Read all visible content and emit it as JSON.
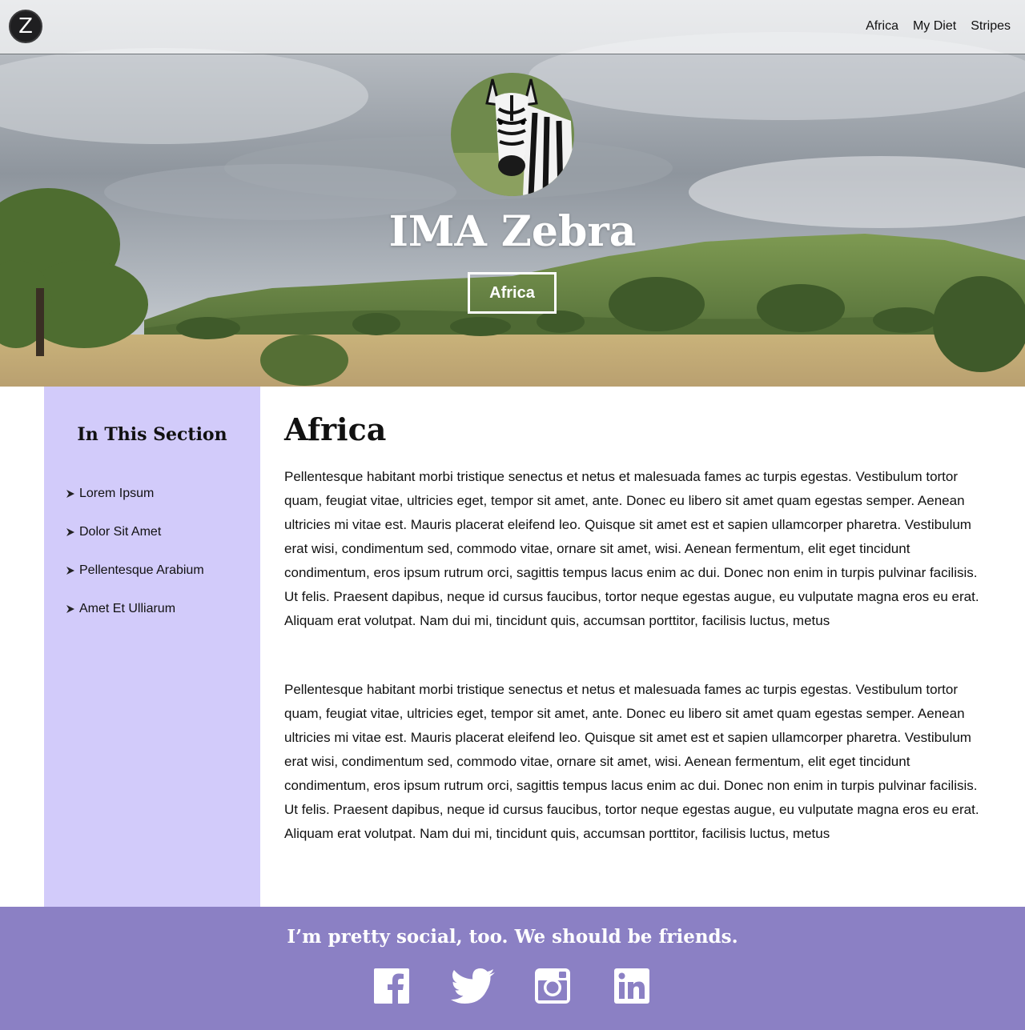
{
  "nav": {
    "logo_letter": "Z",
    "links": [
      "Africa",
      "My Diet",
      "Stripes"
    ]
  },
  "hero": {
    "title": "IMA Zebra",
    "button_label": "Africa"
  },
  "sidebar": {
    "title": "In This Section",
    "items": [
      {
        "label": "Lorem Ipsum"
      },
      {
        "label": "Dolor Sit Amet"
      },
      {
        "label": "Pellentesque Arabium"
      },
      {
        "label": "Amet Et Ulliarum"
      }
    ]
  },
  "main": {
    "title": "Africa",
    "paragraphs": [
      "Pellentesque habitant morbi tristique senectus et netus et malesuada fames ac turpis egestas. Vestibulum tortor quam, feugiat vitae, ultricies eget, tempor sit amet, ante. Donec eu libero sit amet quam egestas semper. Aenean ultricies mi vitae est. Mauris placerat eleifend leo. Quisque sit amet est et sapien ullamcorper pharetra. Vestibulum erat wisi, condimentum sed, commodo vitae, ornare sit amet, wisi. Aenean fermentum, elit eget tincidunt condimentum, eros ipsum rutrum orci, sagittis tempus lacus enim ac dui. Donec non enim in turpis pulvinar facilisis. Ut felis. Praesent dapibus, neque id cursus faucibus, tortor neque egestas augue, eu vulputate magna eros eu erat. Aliquam erat volutpat. Nam dui mi, tincidunt quis, accumsan porttitor, facilisis luctus, metus",
      "Pellentesque habitant morbi tristique senectus et netus et malesuada fames ac turpis egestas. Vestibulum tortor quam, feugiat vitae, ultricies eget, tempor sit amet, ante. Donec eu libero sit amet quam egestas semper. Aenean ultricies mi vitae est. Mauris placerat eleifend leo. Quisque sit amet est et sapien ullamcorper pharetra. Vestibulum erat wisi, condimentum sed, commodo vitae, ornare sit amet, wisi. Aenean fermentum, elit eget tincidunt condimentum, eros ipsum rutrum orci, sagittis tempus lacus enim ac dui. Donec non enim in turpis pulvinar facilisis. Ut felis. Praesent dapibus, neque id cursus faucibus, tortor neque egestas augue, eu vulputate magna eros eu erat. Aliquam erat volutpat. Nam dui mi, tincidunt quis, accumsan porttitor, facilisis luctus, metus"
    ]
  },
  "footer": {
    "text": "I’m pretty social, too. We should be friends.",
    "social": [
      {
        "icon": "facebook-icon"
      },
      {
        "icon": "twitter-icon"
      },
      {
        "icon": "instagram-icon"
      },
      {
        "icon": "linkedin-icon"
      }
    ]
  },
  "colors": {
    "sidebar_bg": "#d2cbfa",
    "footer_bg": "#8b80c4",
    "nav_bg": "rgba(255,255,255,0.62)"
  }
}
